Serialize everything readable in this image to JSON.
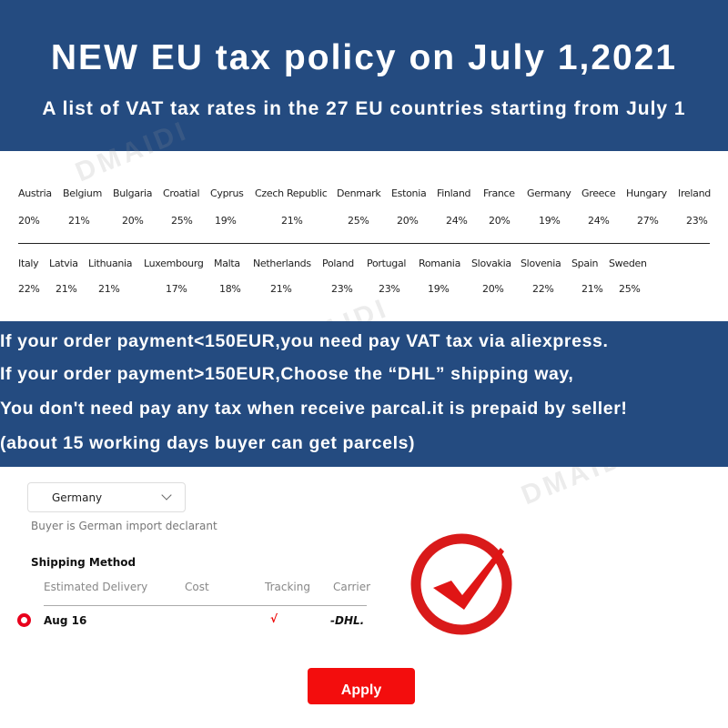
{
  "header": {
    "title": "NEW EU tax policy on July 1,2021",
    "subtitle": "A list of VAT tax rates in the 27 EU countries starting from July 1"
  },
  "watermark": "DMAIDI",
  "rates_row1": [
    [
      "Austria",
      "20%"
    ],
    [
      "Belgium",
      "21%"
    ],
    [
      "Bulgaria",
      "20%"
    ],
    [
      "Croatial",
      "25%"
    ],
    [
      "Cyprus",
      "19%"
    ],
    [
      "Czech Republic",
      "21%"
    ],
    [
      "Denmark",
      "25%"
    ],
    [
      "Estonia",
      "20%"
    ],
    [
      "Finland",
      "24%"
    ],
    [
      "France",
      "20%"
    ],
    [
      "Germany",
      "19%"
    ],
    [
      "Greece",
      "24%"
    ],
    [
      "Hungary",
      "27%"
    ],
    [
      "Ireland",
      "23%"
    ]
  ],
  "rates_row2": [
    [
      "Italy",
      "22%"
    ],
    [
      "Latvia",
      "21%"
    ],
    [
      "Lithuania",
      "21%"
    ],
    [
      "Luxembourg",
      "17%"
    ],
    [
      "Malta",
      "18%"
    ],
    [
      "Netherlands",
      "21%"
    ],
    [
      "Poland",
      "23%"
    ],
    [
      "Portugal",
      "23%"
    ],
    [
      "Romania",
      "19%"
    ],
    [
      "Slovakia",
      "20%"
    ],
    [
      "Slovenia",
      "22%"
    ],
    [
      "Spain",
      "21%"
    ],
    [
      "Sweden",
      "25%"
    ]
  ],
  "notice": [
    "If your order payment<150EUR,you need pay VAT tax via aliexpress.",
    "If your order payment>150EUR,Choose the “DHL” shipping way,",
    "You don't need pay any tax when receive parcal.it is prepaid by seller!",
    "(about 15 working days buyer can get parcels)"
  ],
  "shipping": {
    "country": "Germany",
    "declarant_note": "Buyer is German import declarant",
    "section_title": "Shipping Method",
    "columns": [
      "Estimated Delivery",
      "Cost",
      "Tracking",
      "Carrier"
    ],
    "row": {
      "delivery": "Aug 16",
      "cost": "",
      "tracking": "√",
      "carrier": "-DHL."
    },
    "apply_label": "Apply"
  },
  "colors": {
    "blue": "#244b80",
    "red": "#f30d0d"
  }
}
